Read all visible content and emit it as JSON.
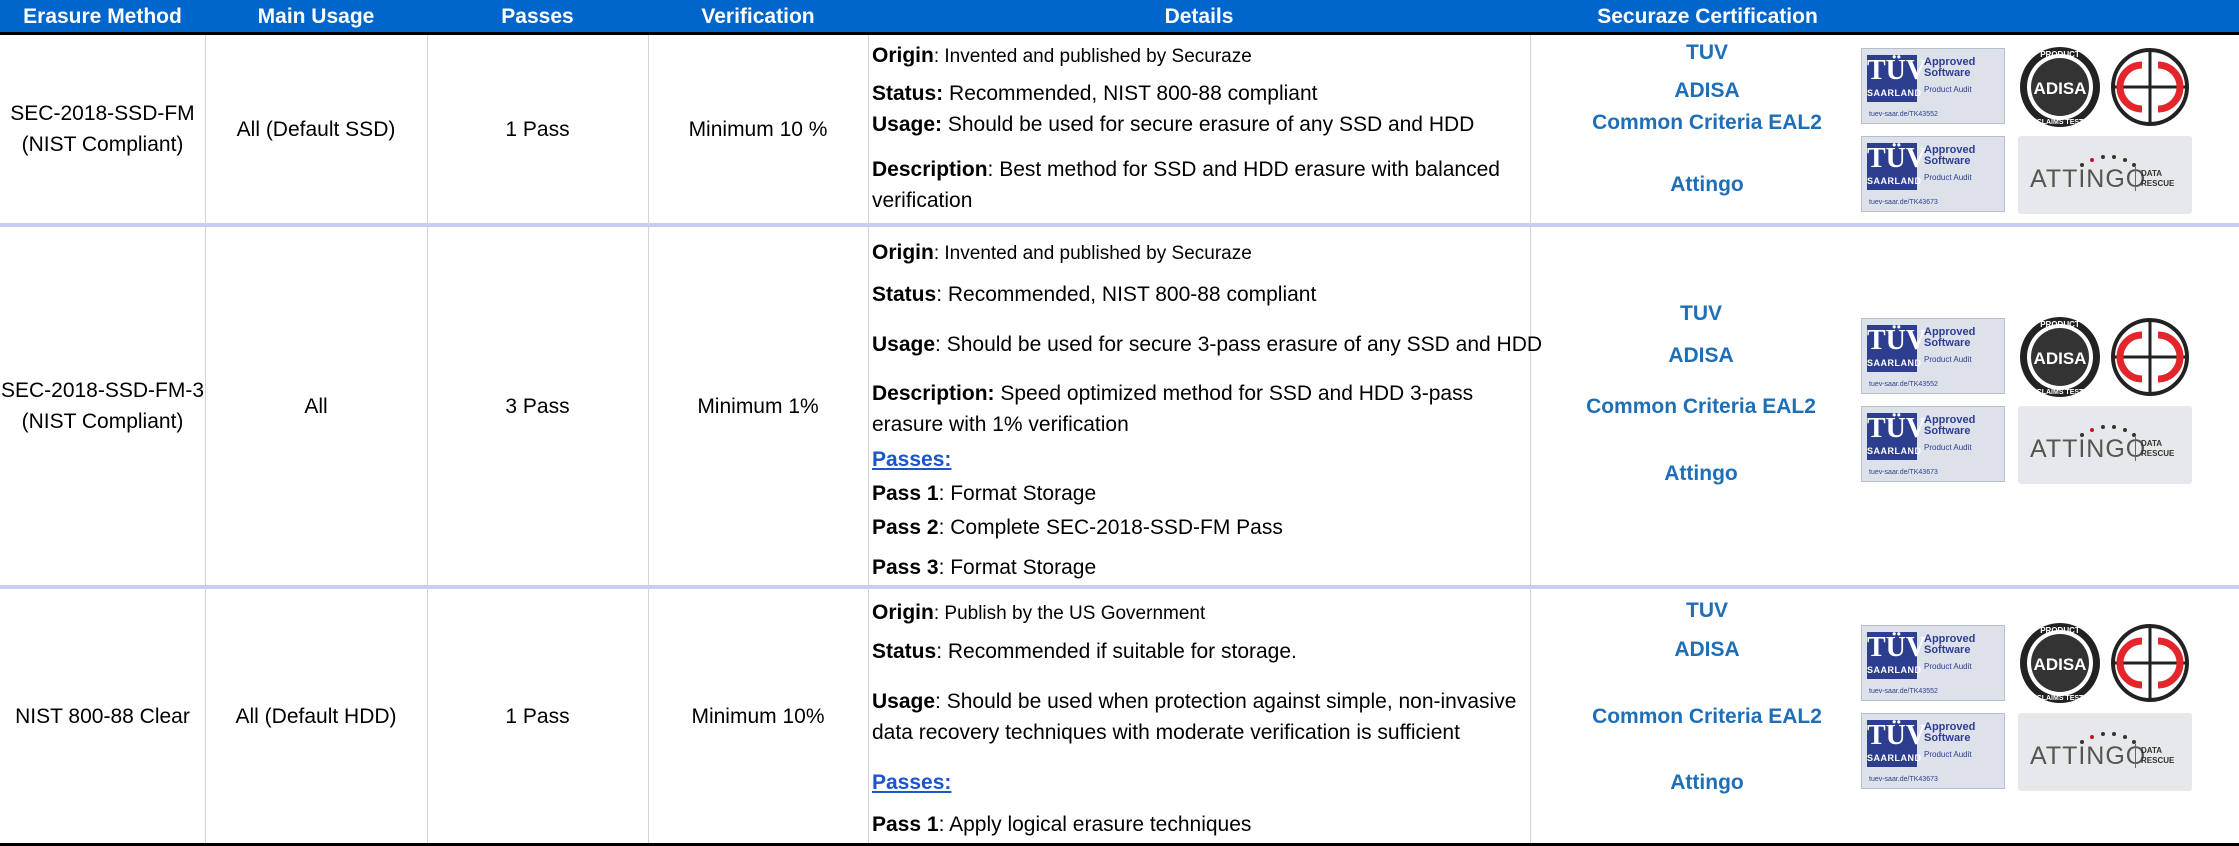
{
  "headers": [
    "Erasure Method",
    "Main Usage",
    "Passes",
    "Verification",
    "Details",
    "Securaze Certification"
  ],
  "rows": [
    {
      "method_line1": "SEC-2018-SSD-FM",
      "method_line2": "(NIST Compliant)",
      "usage": "All (Default SSD)",
      "passes": "1 Pass",
      "verification": "Minimum 10 %",
      "details": {
        "origin_label": "Origin",
        "origin": ": Invented and published by Securaze",
        "status_label": "Status:",
        "status": " Recommended, NIST 800-88 compliant",
        "usage_label": "Usage:",
        "usage": " Should be used for secure erasure of any SSD and HDD",
        "description_label": "Description",
        "description": ": Best method for SSD and HDD erasure with balanced verification"
      },
      "certs": [
        "TUV",
        "ADISA",
        "Common Criteria EAL2",
        "Attingo"
      ]
    },
    {
      "method_line1": "SEC-2018-SSD-FM-3",
      "method_line2": "(NIST Compliant)",
      "usage": "All",
      "passes": "3 Pass",
      "verification": "Minimum 1%",
      "details": {
        "origin_label": "Origin",
        "origin": ": Invented and published by Securaze",
        "status_label": "Status",
        "status": ": Recommended, NIST 800-88 compliant",
        "usage_label": "Usage",
        "usage": ": Should be used for secure 3-pass erasure of any SSD and HDD",
        "description_label": "Description:",
        "description": " Speed optimized method for SSD and HDD 3-pass erasure with 1% verification",
        "passes_link": "Passes:",
        "pass_items": [
          {
            "label": "Pass 1",
            "text": ": Format Storage"
          },
          {
            "label": "Pass 2",
            "text": ": Complete SEC-2018-SSD-FM Pass"
          },
          {
            "label": "Pass 3",
            "text": ": Format Storage"
          }
        ]
      },
      "certs": [
        "TUV",
        "ADISA",
        "Common Criteria EAL2",
        "Attingo"
      ]
    },
    {
      "method_line1": "NIST 800-88 Clear",
      "usage": "All (Default HDD)",
      "passes": "1 Pass",
      "verification": "Minimum 10%",
      "details": {
        "origin_label": "Origin",
        "origin": ": Publish by the US Government",
        "status_label": "Status",
        "status": ": Recommended if suitable for storage.",
        "usage_label": "Usage",
        "usage": ": Should be used when protection against simple, non-invasive data recovery techniques with moderate verification is sufficient",
        "passes_link": "Passes:",
        "pass_items": [
          {
            "label": "Pass 1",
            "text": ": Apply logical erasure techniques"
          }
        ]
      },
      "certs": [
        "TUV",
        "ADISA",
        "Common Criteria EAL2",
        "Attingo"
      ]
    }
  ],
  "logos": {
    "tuv_main": "TÜV",
    "tuv_sub": "SAARLAND",
    "approved": "Approved",
    "software": "Software",
    "product_audit": "Product Audit",
    "url1": "tuev-saar.de/TK43552",
    "url2": "tuev-saar.de/TK43673",
    "adisa_top": "PRODUCT",
    "adisa_mid": "ADISA",
    "adisa_bottom": "CLAIMS TEST",
    "attingo": "ATTINGO",
    "data_rescue": "DATA RESCUE"
  },
  "colors": {
    "header_bg": "#0066cc",
    "cert_text": "#1f6fb8",
    "row_separator": "#c9cdf5",
    "link": "#1a55c9"
  }
}
